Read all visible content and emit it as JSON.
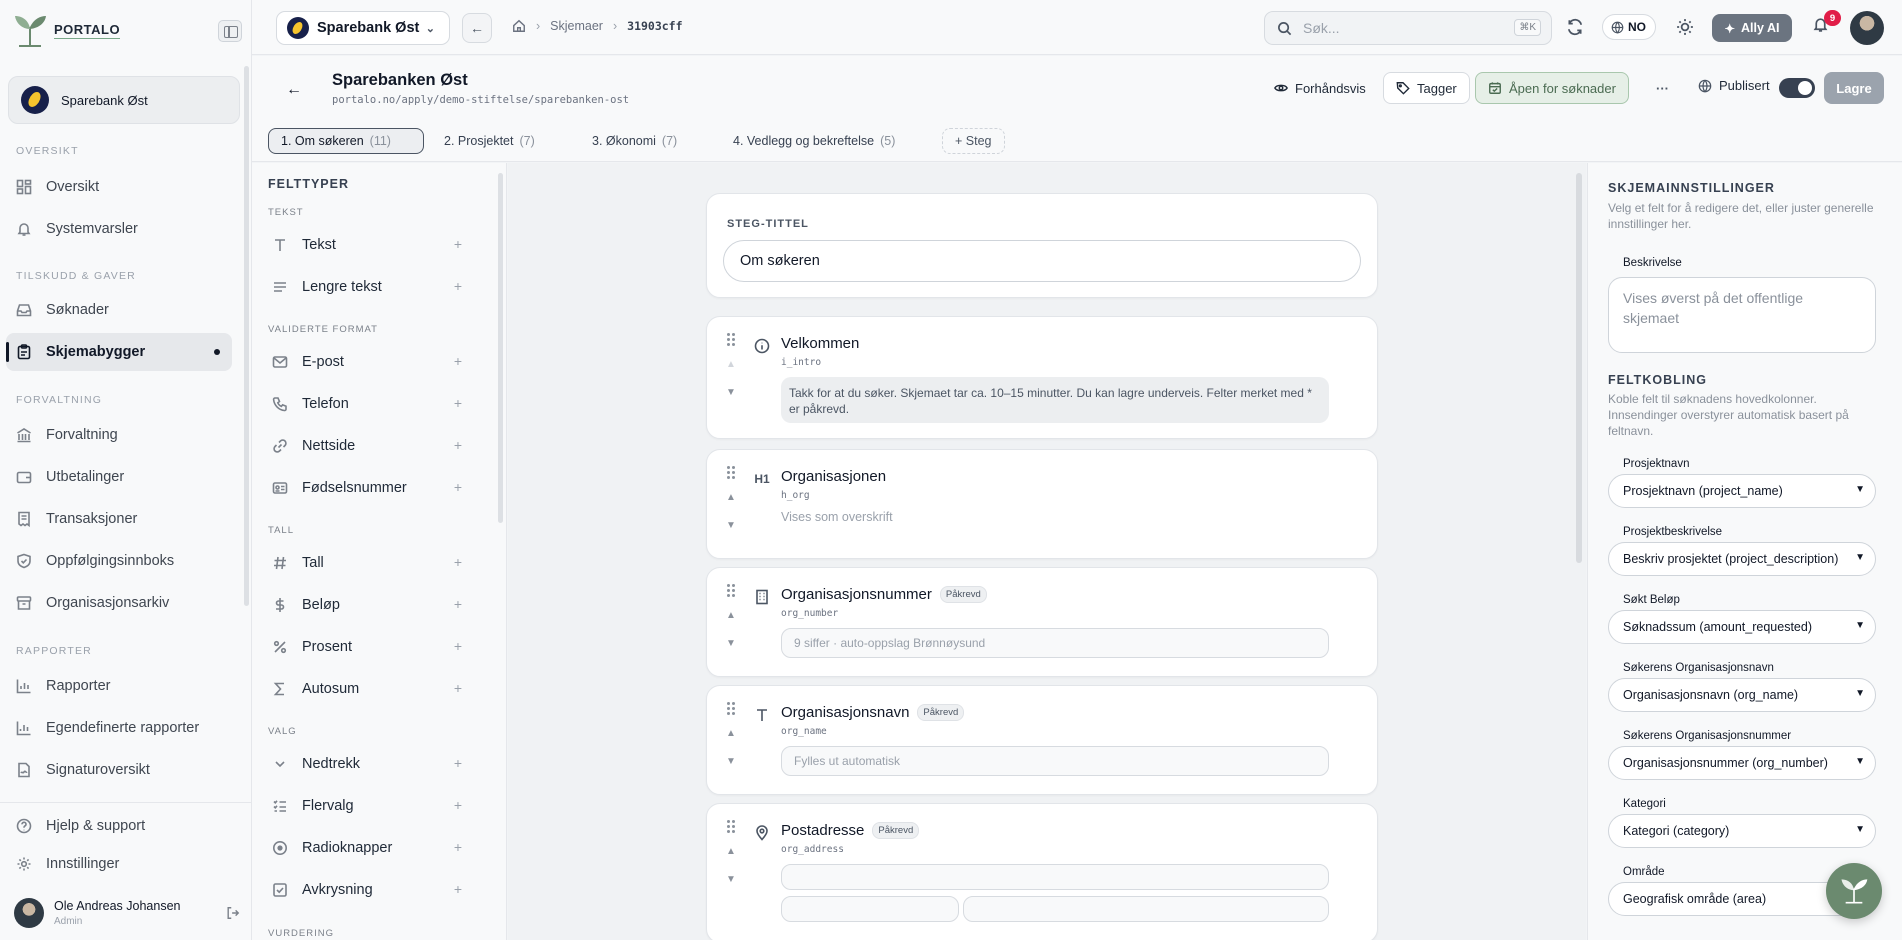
{
  "brand": {
    "name": "PORTALO",
    "accent": "#6b8a6f"
  },
  "sidebar": {
    "org_name": "Sparebank Øst",
    "sections": {
      "oversikt": "OVERSIKT",
      "tilskudd": "TILSKUDD & GAVER",
      "forvaltning": "FORVALTNING",
      "rapporter": "RAPPORTER"
    },
    "items": {
      "oversikt": "Oversikt",
      "systemvarsler": "Systemvarsler",
      "soknader": "Søknader",
      "skjemabygger": "Skjemabygger",
      "forvaltning": "Forvaltning",
      "utbetalinger": "Utbetalinger",
      "transaksjoner": "Transaksjoner",
      "oppfolging": "Oppfølgingsinnboks",
      "organisasjonsarkiv": "Organisasjonsarkiv",
      "rapporter": "Rapporter",
      "egendefinerte": "Egendefinerte rapporter",
      "signatur": "Signaturoversikt"
    },
    "footer": {
      "help": "Hjelp & support",
      "settings": "Innstillinger"
    },
    "user": {
      "name": "Ole Andreas Johansen",
      "role": "Admin"
    }
  },
  "topbar": {
    "org_switch": "Sparebank Øst",
    "breadcrumb": {
      "forms": "Skjemaer",
      "id": "31903cff"
    },
    "search_placeholder": "Søk...",
    "search_shortcut": "⌘K",
    "language": "NO",
    "ally": "Ally AI",
    "notifications": "9"
  },
  "page": {
    "title": "Sparebanken Øst",
    "url": "portalo.no/apply/demo-stiftelse/sparebanken-ost",
    "preview": "Forhåndsvis",
    "tags": "Tagger",
    "status": "Åpen for søknader",
    "more": "···",
    "published": "Publisert",
    "save": "Lagre"
  },
  "steps": [
    {
      "label": "1. Om søkeren",
      "count": "(11)"
    },
    {
      "label": "2. Prosjektet",
      "count": "(7)"
    },
    {
      "label": "3. Økonomi",
      "count": "(7)"
    },
    {
      "label": "4. Vedlegg og bekreftelse",
      "count": "(5)"
    }
  ],
  "add_step": "+ Steg",
  "palette": {
    "title": "FELTTYPER",
    "sections": {
      "tekst": "TEKST",
      "validerte": "VALIDERTE FORMAT",
      "tall": "TALL",
      "valg": "VALG",
      "vurdering": "VURDERING"
    },
    "items": {
      "tekst": "Tekst",
      "lengre": "Lengre tekst",
      "epost": "E-post",
      "telefon": "Telefon",
      "nettside": "Nettside",
      "fodselsnummer": "Fødselsnummer",
      "tall": "Tall",
      "belop": "Beløp",
      "prosent": "Prosent",
      "autosum": "Autosum",
      "nedtrekk": "Nedtrekk",
      "flervalg": "Flervalg",
      "radioknapper": "Radioknapper",
      "avkrysning": "Avkrysning"
    },
    "plus": "+"
  },
  "canvas": {
    "step_title_label": "STEG-TITTEL",
    "step_title_value": "Om søkeren",
    "required_label": "Påkrevd",
    "fields": {
      "velkommen": {
        "title": "Velkommen",
        "key": "i_intro",
        "text": "Takk for at du søker. Skjemaet tar ca. 10–15 minutter. Du kan lagre underveis. Felter merket med * er påkrevd."
      },
      "organisasjonen": {
        "title": "Organisasjonen",
        "key": "h_org",
        "hint": "Vises som overskrift",
        "icon_text": "H1"
      },
      "orgnummer": {
        "title": "Organisasjonsnummer",
        "key": "org_number",
        "placeholder": "9 siffer · auto-oppslag Brønnøysund"
      },
      "orgnavn": {
        "title": "Organisasjonsnavn",
        "key": "org_name",
        "placeholder": "Fylles ut automatisk"
      },
      "postadresse": {
        "title": "Postadresse",
        "key": "org_address"
      }
    }
  },
  "settings": {
    "title": "SKJEMAINNSTILLINGER",
    "desc": "Velg et felt for å redigere det, eller juster generelle innstillinger her.",
    "description_label": "Beskrivelse",
    "description_placeholder": "Vises øverst på det offentlige skjemaet",
    "mapping_title": "FELTKOBLING",
    "mapping_desc": "Koble felt til søknadens hovedkolonner. Innsendinger overstyrer automatisk basert på feltnavn.",
    "mappings": [
      {
        "label": "Prosjektnavn",
        "value": "Prosjektnavn (project_name)"
      },
      {
        "label": "Prosjektbeskrivelse",
        "value": "Beskriv prosjektet (project_description)"
      },
      {
        "label": "Søkt Beløp",
        "value": "Søknadssum (amount_requested)"
      },
      {
        "label": "Søkerens Organisasjonsnavn",
        "value": "Organisasjonsnavn (org_name)"
      },
      {
        "label": "Søkerens Organisasjonsnummer",
        "value": "Organisasjonsnummer (org_number)"
      },
      {
        "label": "Kategori",
        "value": "Kategori (category)"
      },
      {
        "label": "Område",
        "value": "Geografisk område (area)"
      }
    ]
  }
}
